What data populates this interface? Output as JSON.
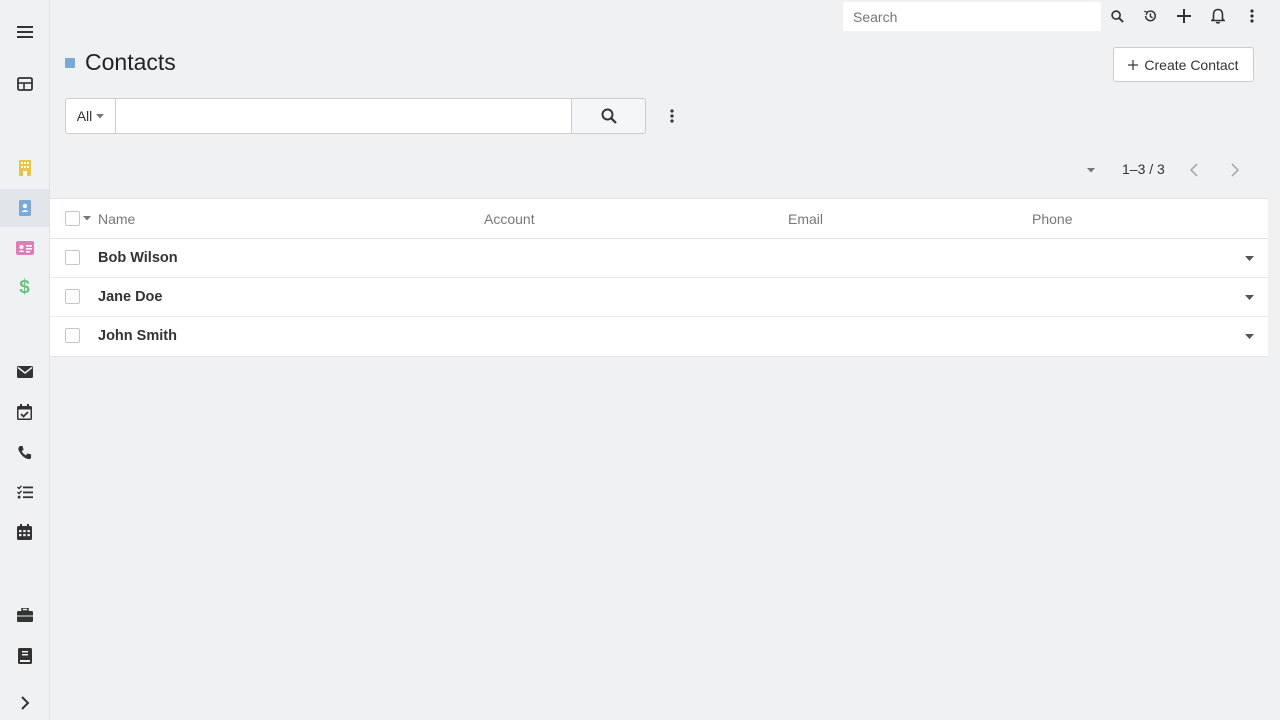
{
  "app": {
    "colors": {
      "accent": "#7aa9d9",
      "accounts_icon": "#e8c547",
      "contacts_icon": "#7aa9d9",
      "leads_icon": "#e07bb7",
      "opportunities_icon": "#6bc17e",
      "background": "#f0f1f3"
    }
  },
  "sidebar": {
    "items": [
      {
        "icon": "hamburger-menu-icon"
      },
      {
        "icon": "dashboard-grid-icon"
      },
      {
        "icon": "building-icon",
        "label": "Accounts"
      },
      {
        "icon": "contact-card-icon",
        "label": "Contacts",
        "active": true
      },
      {
        "icon": "id-card-icon",
        "label": "Leads"
      },
      {
        "icon": "dollar-icon",
        "label": "Opportunities"
      },
      {
        "icon": "envelope-icon",
        "label": "Emails"
      },
      {
        "icon": "calendar-check-icon",
        "label": "Meetings"
      },
      {
        "icon": "phone-icon",
        "label": "Calls"
      },
      {
        "icon": "task-list-icon",
        "label": "Tasks"
      },
      {
        "icon": "calendar-icon",
        "label": "Calendar"
      },
      {
        "icon": "briefcase-icon"
      },
      {
        "icon": "book-icon"
      },
      {
        "icon": "chevron-right-icon"
      }
    ]
  },
  "topbar": {
    "search_placeholder": "Search",
    "icons": [
      "search-icon",
      "history-icon",
      "plus-icon",
      "bell-icon",
      "more-vertical-icon"
    ]
  },
  "header": {
    "title": "Contacts",
    "create_button_label": "Create Contact"
  },
  "filter": {
    "scope_label": "All",
    "text_value": ""
  },
  "pagination": {
    "info": "1–3 / 3"
  },
  "table": {
    "columns": [
      "Name",
      "Account",
      "Email",
      "Phone"
    ],
    "rows": [
      {
        "name": "Bob Wilson",
        "account": "",
        "email": "",
        "phone": ""
      },
      {
        "name": "Jane Doe",
        "account": "",
        "email": "",
        "phone": ""
      },
      {
        "name": "John Smith",
        "account": "",
        "email": "",
        "phone": ""
      }
    ]
  }
}
